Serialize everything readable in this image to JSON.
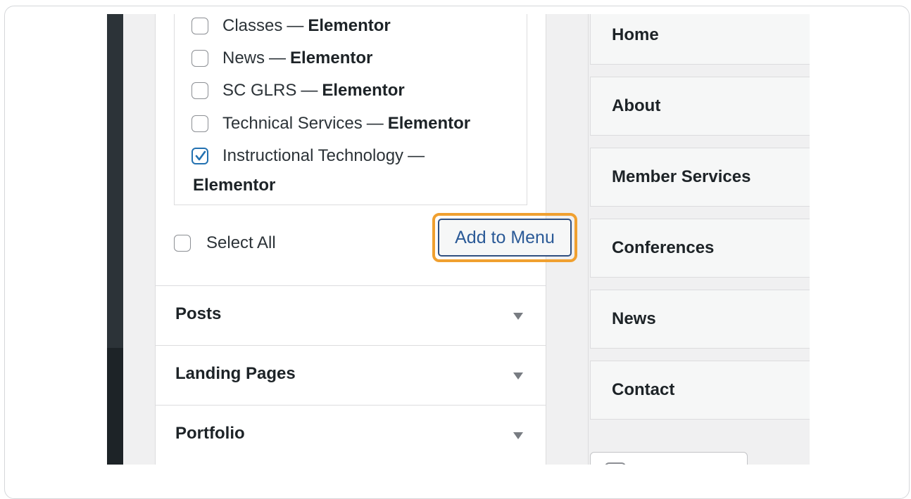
{
  "pages_checklist": {
    "items": [
      {
        "title": "Classes",
        "sep": "—",
        "suffix": "Elementor",
        "checked": false
      },
      {
        "title": "News",
        "sep": "—",
        "suffix": "Elementor",
        "checked": false
      },
      {
        "title": "SC GLRS",
        "sep": "—",
        "suffix": "Elementor",
        "checked": false
      },
      {
        "title": "Technical Services",
        "sep": "—",
        "suffix": "Elementor",
        "checked": false
      },
      {
        "title": "Instructional Technology",
        "sep": "—",
        "suffix": "Elementor",
        "checked": true
      }
    ],
    "select_all_label": "Select All",
    "add_button_label": "Add to Menu"
  },
  "accordion": [
    {
      "label": "Posts"
    },
    {
      "label": "Landing Pages"
    },
    {
      "label": "Portfolio"
    }
  ],
  "menu_structure": [
    {
      "label": "Home"
    },
    {
      "label": "About"
    },
    {
      "label": "Member Services"
    },
    {
      "label": "Conferences"
    },
    {
      "label": "News"
    },
    {
      "label": "Contact"
    }
  ],
  "colors": {
    "highlight": "#f0a030",
    "accent": "#2271b1",
    "admin_bar": "#2c3338"
  }
}
